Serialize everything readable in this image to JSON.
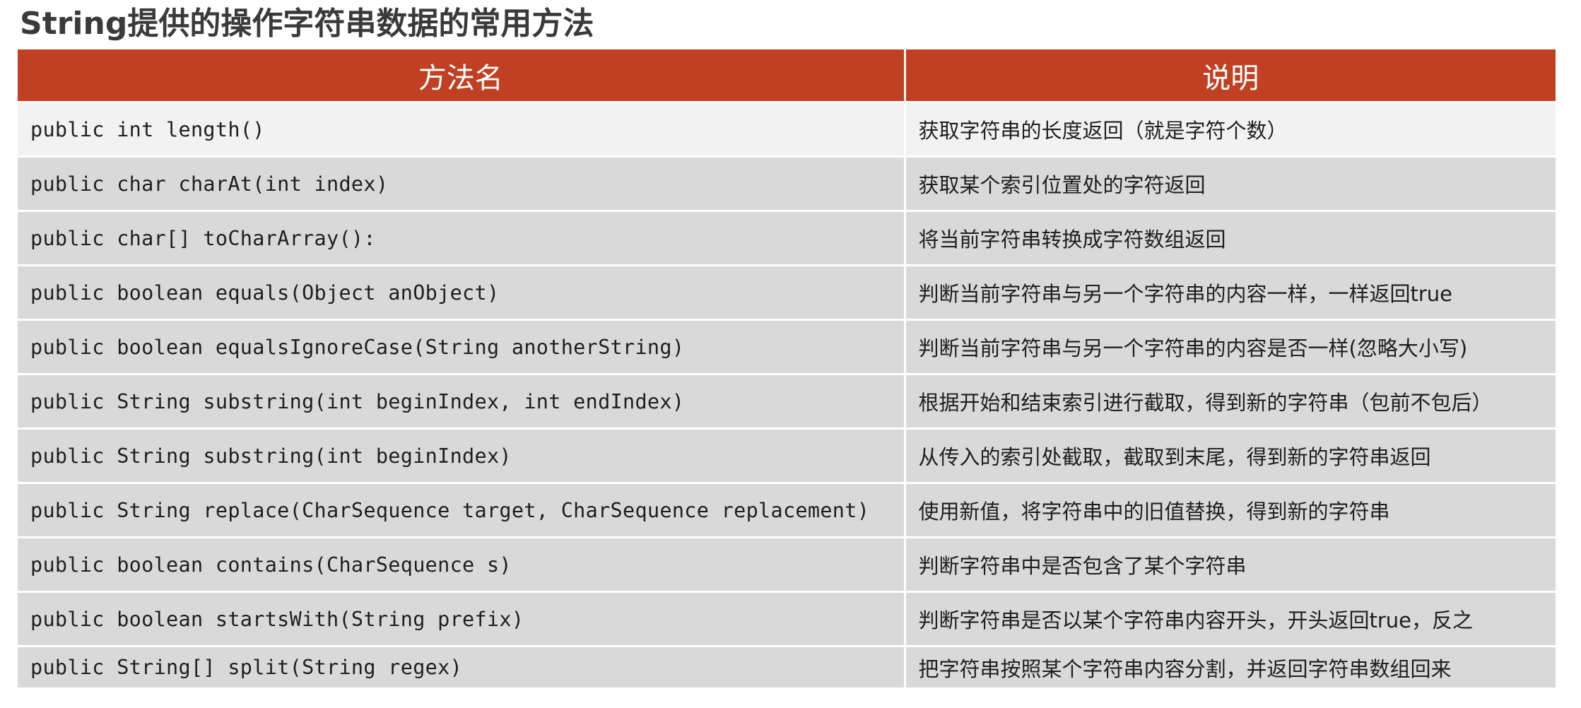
{
  "page": {
    "title": "String提供的操作字符串数据的常用方法"
  },
  "table": {
    "header_color": "#c13f22",
    "headers": [
      "方法名",
      "说明"
    ],
    "rows": [
      {
        "method": "public int length()",
        "description": "获取字符串的长度返回（就是字符个数）"
      },
      {
        "method": "public char charAt(int index)",
        "description": "获取某个索引位置处的字符返回"
      },
      {
        "method": "public char[] toCharArray():",
        "description": "将当前字符串转换成字符数组返回"
      },
      {
        "method": "public boolean equals(Object anObject)",
        "description": "判断当前字符串与另一个字符串的内容一样，一样返回true"
      },
      {
        "method": "public boolean equalsIgnoreCase(String anotherString)",
        "description": "判断当前字符串与另一个字符串的内容是否一样(忽略大小写)"
      },
      {
        "method": "public String substring(int beginIndex, int endIndex)",
        "description": "根据开始和结束索引进行截取，得到新的字符串（包前不包后）"
      },
      {
        "method": "public String substring(int beginIndex)",
        "description": "从传入的索引处截取，截取到末尾，得到新的字符串返回"
      },
      {
        "method": "public String replace(CharSequence target, CharSequence replacement)",
        "description": "使用新值，将字符串中的旧值替换，得到新的字符串"
      },
      {
        "method": "public boolean contains(CharSequence s)",
        "description": "判断字符串中是否包含了某个字符串"
      },
      {
        "method": "public boolean startsWith(String prefix)",
        "description": "判断字符串是否以某个字符串内容开头，开头返回true，反之"
      },
      {
        "method": "public String[] split(String regex)",
        "description": "把字符串按照某个字符串内容分割，并返回字符串数组回来"
      }
    ]
  }
}
